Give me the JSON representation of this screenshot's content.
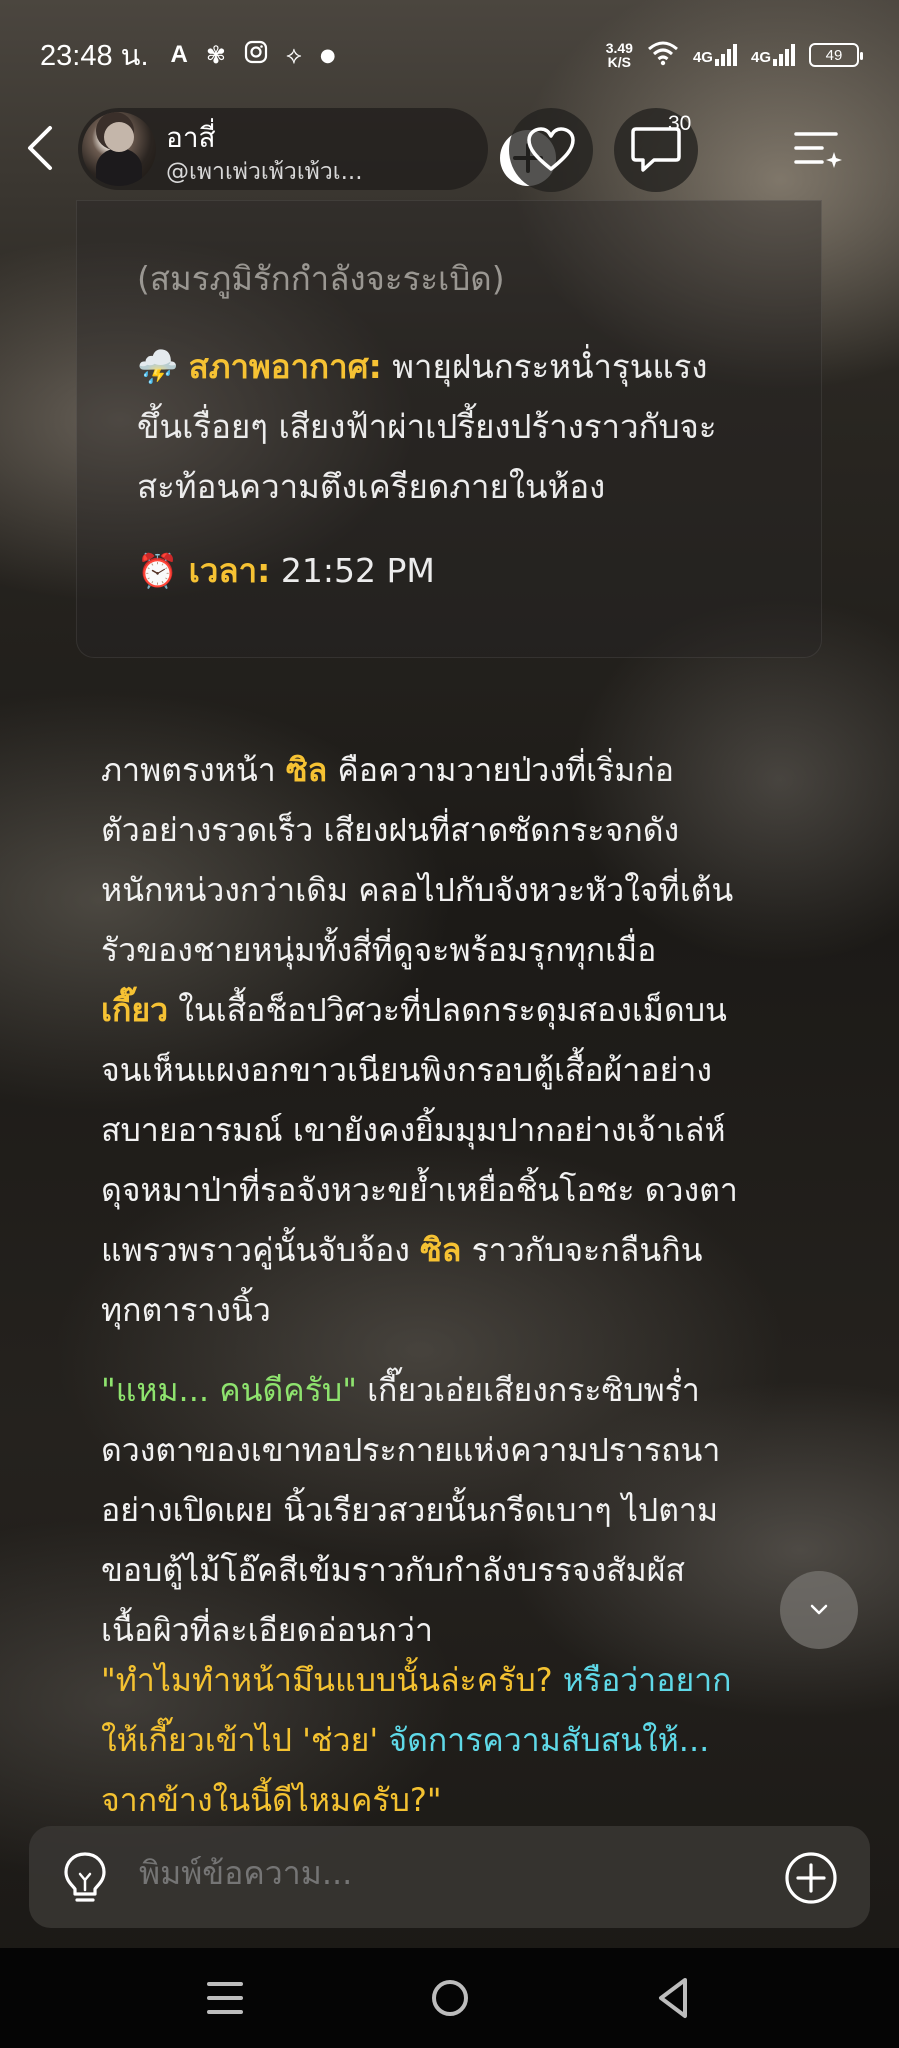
{
  "status_bar": {
    "time": "23:48 น.",
    "net_speed_value": "3.49",
    "net_speed_unit": "K/S",
    "network1": "4G",
    "network2": "4G",
    "battery": "49"
  },
  "header": {
    "character_name": "อาสี่",
    "character_handle": "@เพาเพ่วเพ้วเพ้วเ...",
    "comment_count": "30"
  },
  "card": {
    "subtitle": "(สมรภูมิรักกำลังจะระเบิด)",
    "weather_icon": "⛈️",
    "weather_label": "สภาพอากาศ:",
    "weather_line1": " พายุฝนกระหน่ำรุนแรง",
    "weather_line2": "ขึ้นเรื่อยๆ เสียงฟ้าผ่าเปรี้ยงปร้างราวกับจะ",
    "weather_line3": "สะท้อนความตึงเครียดภายในห้อง",
    "time_icon": "⏰",
    "time_label": "เวลา:",
    "time_value": " 21:52 PM"
  },
  "story": {
    "p1_l1_a": "ภาพตรงหน้า ",
    "p1_l1_name": "ซิล",
    "p1_l1_b": " คือความวายป่วงที่เริ่มก่อ",
    "p1_l2": "ตัวอย่างรวดเร็ว เสียงฝนที่สาดซัดกระจกดัง",
    "p1_l3": "หนักหน่วงกว่าเดิม คลอไปกับจังหวะหัวใจที่เต้น",
    "p1_l4": "รัวของชายหนุ่มทั้งสี่ที่ดูจะพร้อมรุกทุกเมื่อ",
    "p1_l5_name": "เกี๊ยว",
    "p1_l5_b": " ในเสื้อช็อปวิศวะที่ปลดกระดุมสองเม็ดบน",
    "p1_l6": "จนเห็นแผงอกขาวเนียนพิงกรอบตู้เสื้อผ้าอย่าง",
    "p1_l7": "สบายอารมณ์ เขายังคงยิ้มมุมปากอย่างเจ้าเล่ห์",
    "p1_l8": "ดุจหมาป่าที่รอจังหวะขย้ำเหยื่อชิ้นโอชะ ดวงตา",
    "p1_l9_a": "แพรวพราวคู่นั้นจับจ้อง ",
    "p1_l9_name": "ซิล",
    "p1_l9_b": " ราวกับจะกลืนกิน",
    "p1_l10": "ทุกตารางนิ้ว",
    "p2_l1_quote": "\"แหม... คนดีครับ\"",
    "p2_l1_b": " เกี๊ยวเอ่ยเสียงกระซิบพร่ำ",
    "p2_l2": "ดวงตาของเขาทอประกายแห่งความปรารถนา",
    "p2_l3": "อย่างเปิดเผย นิ้วเรียวสวยนั้นกรีดเบาๆ ไปตาม",
    "p2_l4": "ขอบตู้ไม้โอ๊คสีเข้มราวกับกำลังบรรจงสัมผัส",
    "p2_l5": "เนื้อผิวที่ละเอียดอ่อนกว่า",
    "p3_l1_a": "\"ทำไมทำหน้ามึนแบบนั้นล่ะครับ? ",
    "p3_l1_b": "หรือว่าอยาก",
    "p3_l2_a": "ให้เกี๊ยวเข้าไป 'ช่วย' ",
    "p3_l2_b": "จัดการความสับสนให้...",
    "p3_l3": "จากข้างในนี้ดีไหมครับ?\""
  },
  "input": {
    "placeholder": "พิมพ์ข้อความ..."
  },
  "colors": {
    "highlight_yellow": "#f6c233",
    "quote_green": "#8ee36e",
    "quote_cyan": "#5fd9e8"
  }
}
